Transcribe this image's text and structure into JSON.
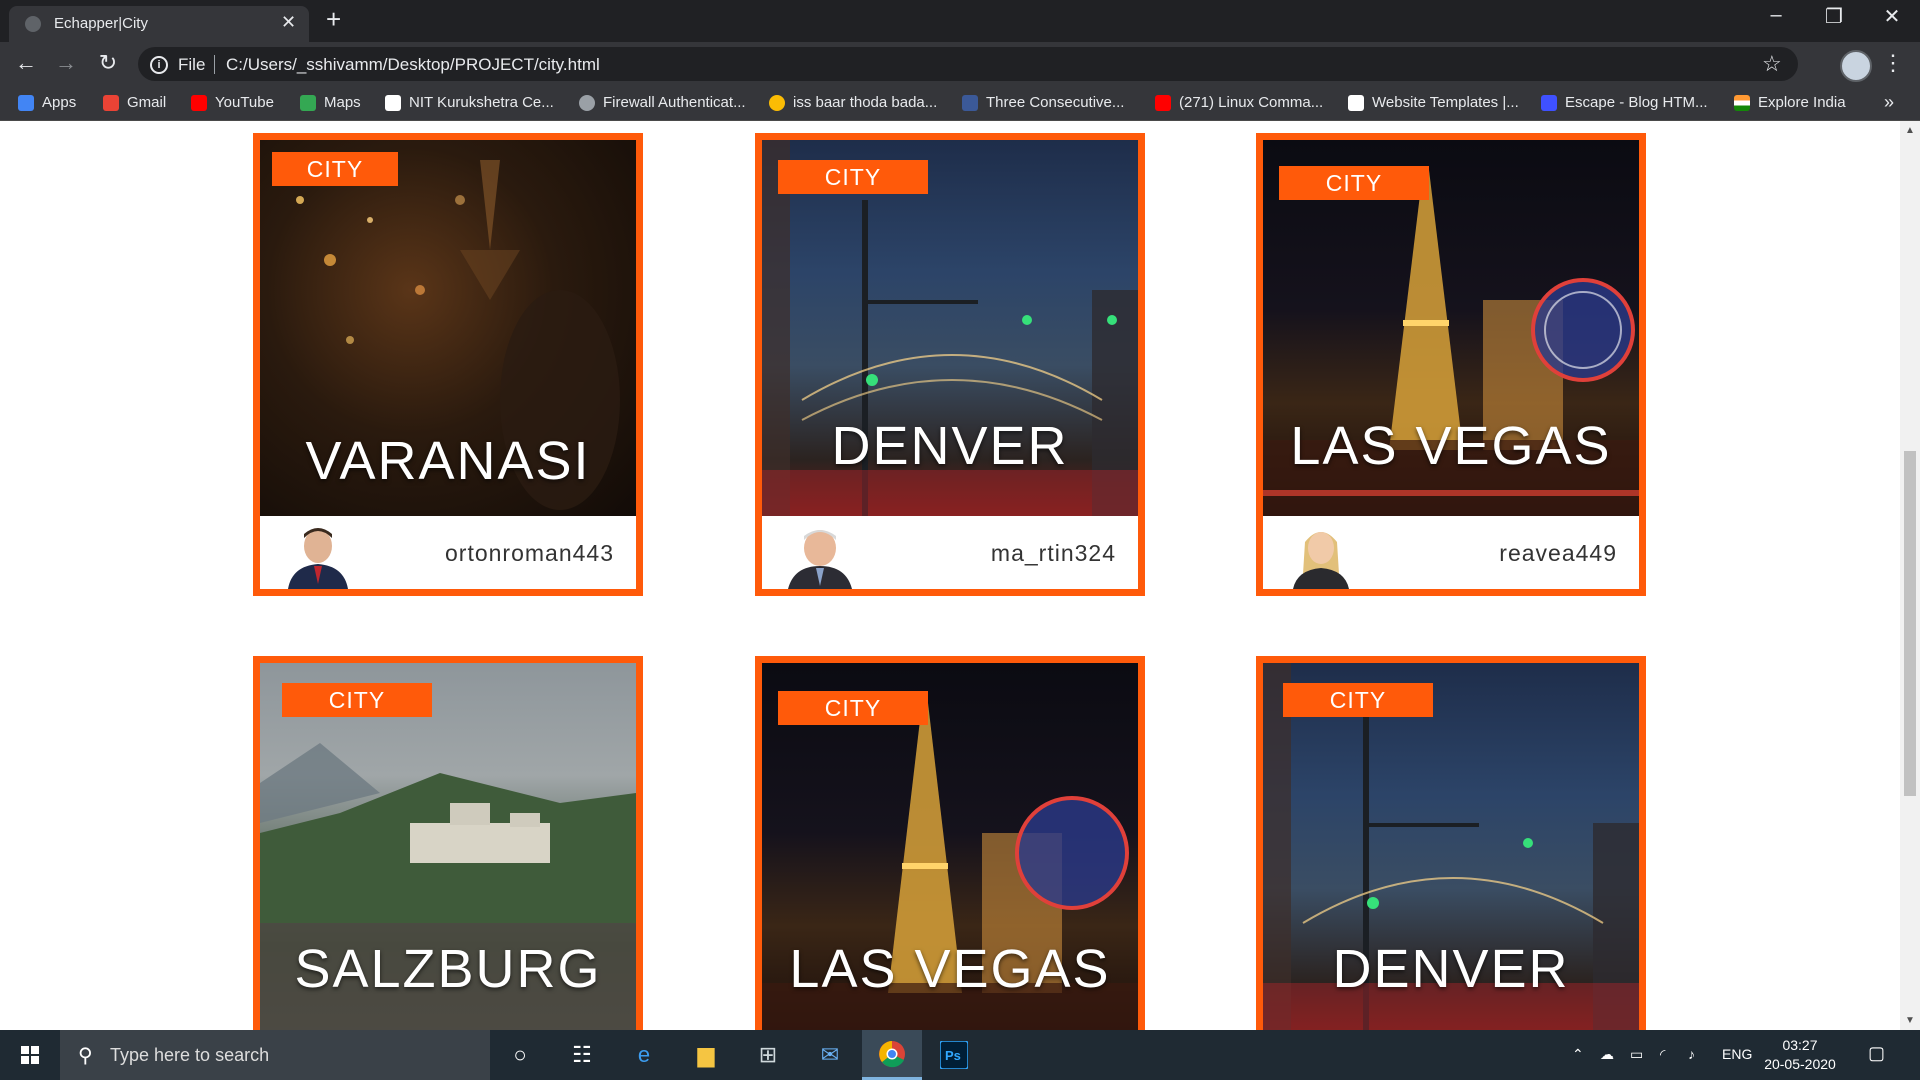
{
  "browser": {
    "tab_title": "Echapper|City",
    "file_label": "File",
    "url": "C:/Users/_sshivamm/Desktop/PROJECT/city.html"
  },
  "bookmarks": [
    {
      "label": "Apps",
      "color": "#4285f4"
    },
    {
      "label": "Gmail",
      "color": "#ea4335"
    },
    {
      "label": "YouTube",
      "color": "#ff0000"
    },
    {
      "label": "Maps",
      "color": "#34a853"
    },
    {
      "label": "NIT Kurukshetra Ce...",
      "color": "#ffffff"
    },
    {
      "label": "Firewall Authenticat...",
      "color": "#9aa0a6"
    },
    {
      "label": "iss baar thoda bada...",
      "color": "#fbbc04"
    },
    {
      "label": "Three Consecutive...",
      "color": "#3b5998"
    },
    {
      "label": "(271) Linux Comma...",
      "color": "#ff0000"
    },
    {
      "label": "Website Templates |...",
      "color": "#ffffff"
    },
    {
      "label": "Escape - Blog HTM...",
      "color": "#3f51ff"
    },
    {
      "label": "Explore India",
      "color": "#ff9933"
    }
  ],
  "cards": [
    {
      "badge": "CITY",
      "city": "VARANASI",
      "author": "ortonroman443"
    },
    {
      "badge": "CITY",
      "city": "DENVER",
      "author": "ma_rtin324"
    },
    {
      "badge": "CITY",
      "city": "LAS VEGAS",
      "author": "reavea449"
    },
    {
      "badge": "CITY",
      "city": "SALZBURG"
    },
    {
      "badge": "CITY",
      "city": "LAS VEGAS"
    },
    {
      "badge": "CITY",
      "city": "DENVER"
    }
  ],
  "taskbar": {
    "search_placeholder": "Type here to search",
    "language": "ENG",
    "time": "03:27",
    "date": "20-05-2020"
  },
  "colors": {
    "accent": "#ff5a0a"
  }
}
